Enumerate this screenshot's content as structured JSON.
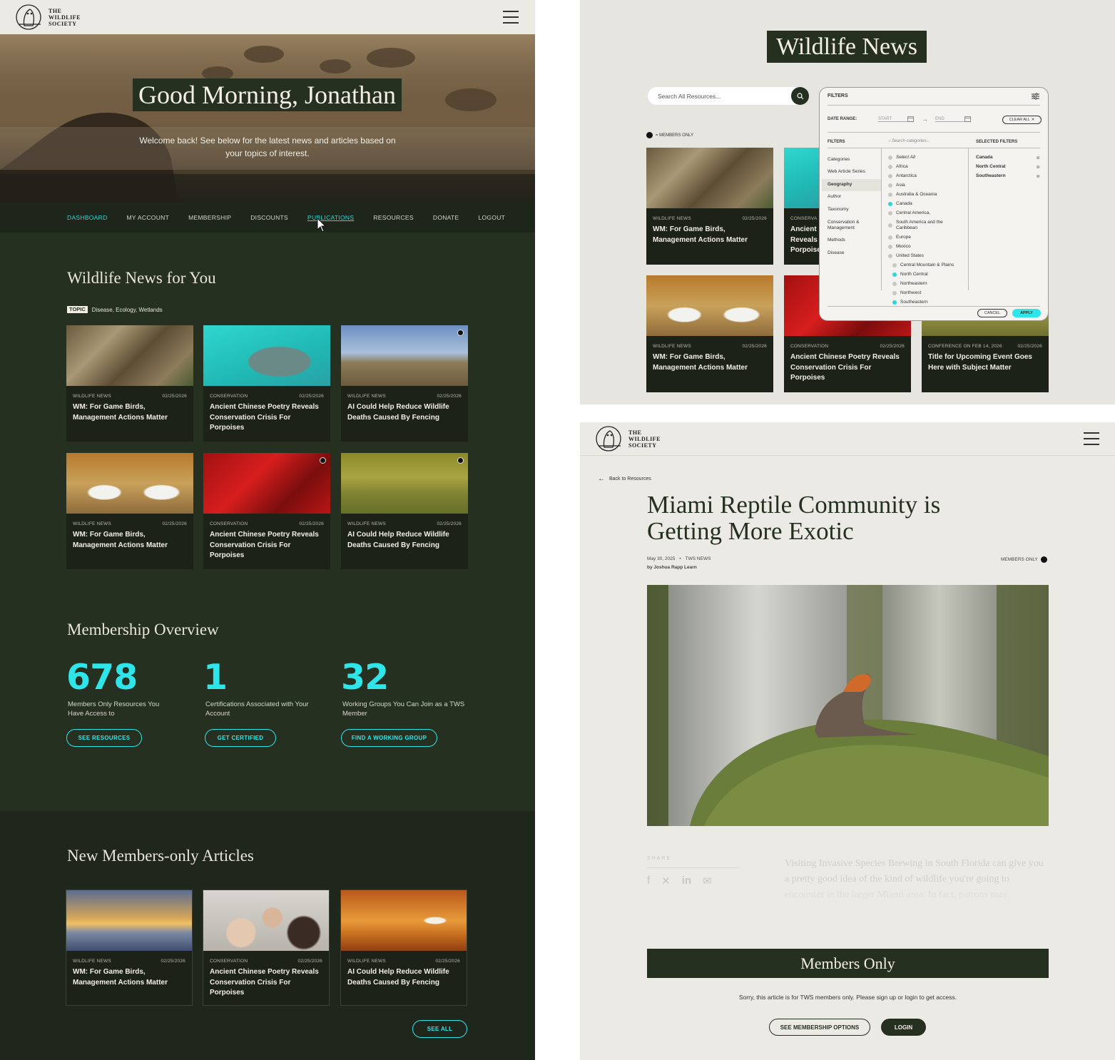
{
  "left": {
    "logo_text": "THE\nWILDLIFE\nSOCIETY",
    "greeting": "Good Morning, Jonathan",
    "welcome": "Welcome back! See below for the latest news and articles based on your topics of interest.",
    "nav": [
      "DASHBOARD",
      "MY ACCOUNT",
      "MEMBERSHIP",
      "DISCOUNTS",
      "PUBLICATIONS",
      "RESOURCES",
      "DONATE",
      "LOGOUT"
    ],
    "news_title": "Wildlife News for You",
    "topic_label": "TOPIC",
    "topic_values": "Disease, Ecology, Wetlands",
    "news_cards": [
      {
        "category": "WILDLIFE NEWS",
        "date": "02/25/2026",
        "title": "WM: For Game Birds, Management Actions Matter",
        "locked": false
      },
      {
        "category": "CONSERVATION",
        "date": "02/25/2026",
        "title": "Ancient Chinese Poetry Reveals Conservation Crisis For Porpoises",
        "locked": false
      },
      {
        "category": "WILDLIFE NEWS",
        "date": "02/25/2026",
        "title": "AI Could Help Reduce Wildlife Deaths Caused By Fencing",
        "locked": true
      },
      {
        "category": "WILDLIFE NEWS",
        "date": "02/25/2026",
        "title": "WM: For Game Birds, Management Actions Matter",
        "locked": false
      },
      {
        "category": "CONSERVATION",
        "date": "02/25/2026",
        "title": "Ancient Chinese Poetry Reveals Conservation Crisis For Porpoises",
        "locked": true
      },
      {
        "category": "WILDLIFE NEWS",
        "date": "02/25/2026",
        "title": "AI Could Help Reduce Wildlife Deaths Caused By Fencing",
        "locked": true
      }
    ],
    "membership_title": "Membership Overview",
    "stats": [
      {
        "value": "678",
        "desc": "Members Only Resources You Have Access to",
        "button": "SEE RESOURCES"
      },
      {
        "value": "1",
        "desc": "Certifications Associated with Your Account",
        "button": "GET CERTIFIED"
      },
      {
        "value": "32",
        "desc": "Working Groups You Can Join as a TWS Member",
        "button": "FIND A WORKING GROUP"
      }
    ],
    "members_title": "New Members-only Articles",
    "member_cards": [
      {
        "category": "WILDLIFE NEWS",
        "date": "02/25/2026",
        "title": "WM: For Game Birds, Management Actions Matter"
      },
      {
        "category": "CONSERVATION",
        "date": "02/25/2026",
        "title": "Ancient Chinese Poetry Reveals Conservation Crisis For Porpoises"
      },
      {
        "category": "WILDLIFE NEWS",
        "date": "02/25/2026",
        "title": "AI Could Help Reduce Wildlife Deaths Caused By Fencing"
      }
    ],
    "see_all": "SEE ALL"
  },
  "right_top": {
    "title": "Wildlife News",
    "search_placeholder": "Search All Resources...",
    "members_only_label": "= MEMBERS ONLY",
    "filters_header": "FILTERS",
    "date_range_label": "DATE RANGE:",
    "start_label": "START",
    "end_label": "END",
    "clear_all": "CLEAR ALL",
    "filters_col_label": "FILTERS",
    "search_categories": "Search categories...",
    "selected_filters_label": "SELECTED FILTERS",
    "categories": [
      "Categories",
      "Web Article Series",
      "Geography",
      "Author",
      "Taxonomy",
      "Conservation & Management",
      "Methods",
      "Disease"
    ],
    "geo_items": [
      {
        "label": "Select All",
        "on": false,
        "indent": false
      },
      {
        "label": "Africa",
        "on": false,
        "indent": false
      },
      {
        "label": "Antarctica",
        "on": false,
        "indent": false
      },
      {
        "label": "Asia",
        "on": false,
        "indent": false
      },
      {
        "label": "Australia & Oceania",
        "on": false,
        "indent": false
      },
      {
        "label": "Canada",
        "on": true,
        "indent": false
      },
      {
        "label": "Central America,",
        "on": false,
        "indent": false
      },
      {
        "label": "South America and the Caribbean",
        "on": false,
        "indent": false
      },
      {
        "label": "Europe",
        "on": false,
        "indent": false
      },
      {
        "label": "Mexico",
        "on": false,
        "indent": false
      },
      {
        "label": "United States",
        "on": false,
        "indent": false
      },
      {
        "label": "Central Mountain & Plains",
        "on": false,
        "indent": true
      },
      {
        "label": "North Central",
        "on": true,
        "indent": true
      },
      {
        "label": "Northeastern",
        "on": false,
        "indent": true
      },
      {
        "label": "Northwest",
        "on": false,
        "indent": true
      },
      {
        "label": "Southeastern",
        "on": true,
        "indent": true
      }
    ],
    "selected": [
      "Canada",
      "North Central",
      "Southeastern"
    ],
    "cancel": "CANCEL",
    "apply": "APPLY",
    "cards": [
      {
        "category": "WILDLIFE NEWS",
        "date": "02/25/2026",
        "title": "WM: For Game Birds, Management Actions Matter"
      },
      {
        "category": "CONSERVA",
        "date": "",
        "title": "Ancient Reveals Porpoise"
      },
      {
        "category": "WILDLIFE NEWS",
        "date": "02/25/2026",
        "title": "WM: For Game Birds, Management Actions Matter"
      },
      {
        "category": "CONSERVATION",
        "date": "02/25/2026",
        "title": "Ancient Chinese Poetry Reveals Conservation Crisis For Porpoises"
      },
      {
        "category": "CONFERENCE ON FEB 14, 2026",
        "date": "02/25/2026",
        "title": "Title for Upcoming Event Goes Here with Subject Matter"
      }
    ]
  },
  "right_bottom": {
    "logo_text": "THE\nWILDLIFE\nSOCIETY",
    "back": "Back to Resources",
    "title": "Miami Reptile Community is Getting More Exotic",
    "date": "May 30, 2025",
    "section": "TWS NEWS",
    "author": "by Joshua Rapp Learn",
    "members_only": "MEMBERS ONLY",
    "share": "SHARE",
    "excerpt": "Visiting Invasive Species Brewing in South Florida can give you a pretty good idea of the kind of wildlife you're going to encounter in the larger Miami area. In fact, patrons may",
    "members_bar": "Members Only",
    "sorry": "Sorry, this article is for TWS members only. Please sign up or login to get access.",
    "btn_options": "SEE MEMBERSHIP OPTIONS",
    "btn_login": "LOGIN"
  },
  "colors": {
    "dark_green": "#263021",
    "accent": "#2ee6ea",
    "cream": "#ebeae4"
  }
}
